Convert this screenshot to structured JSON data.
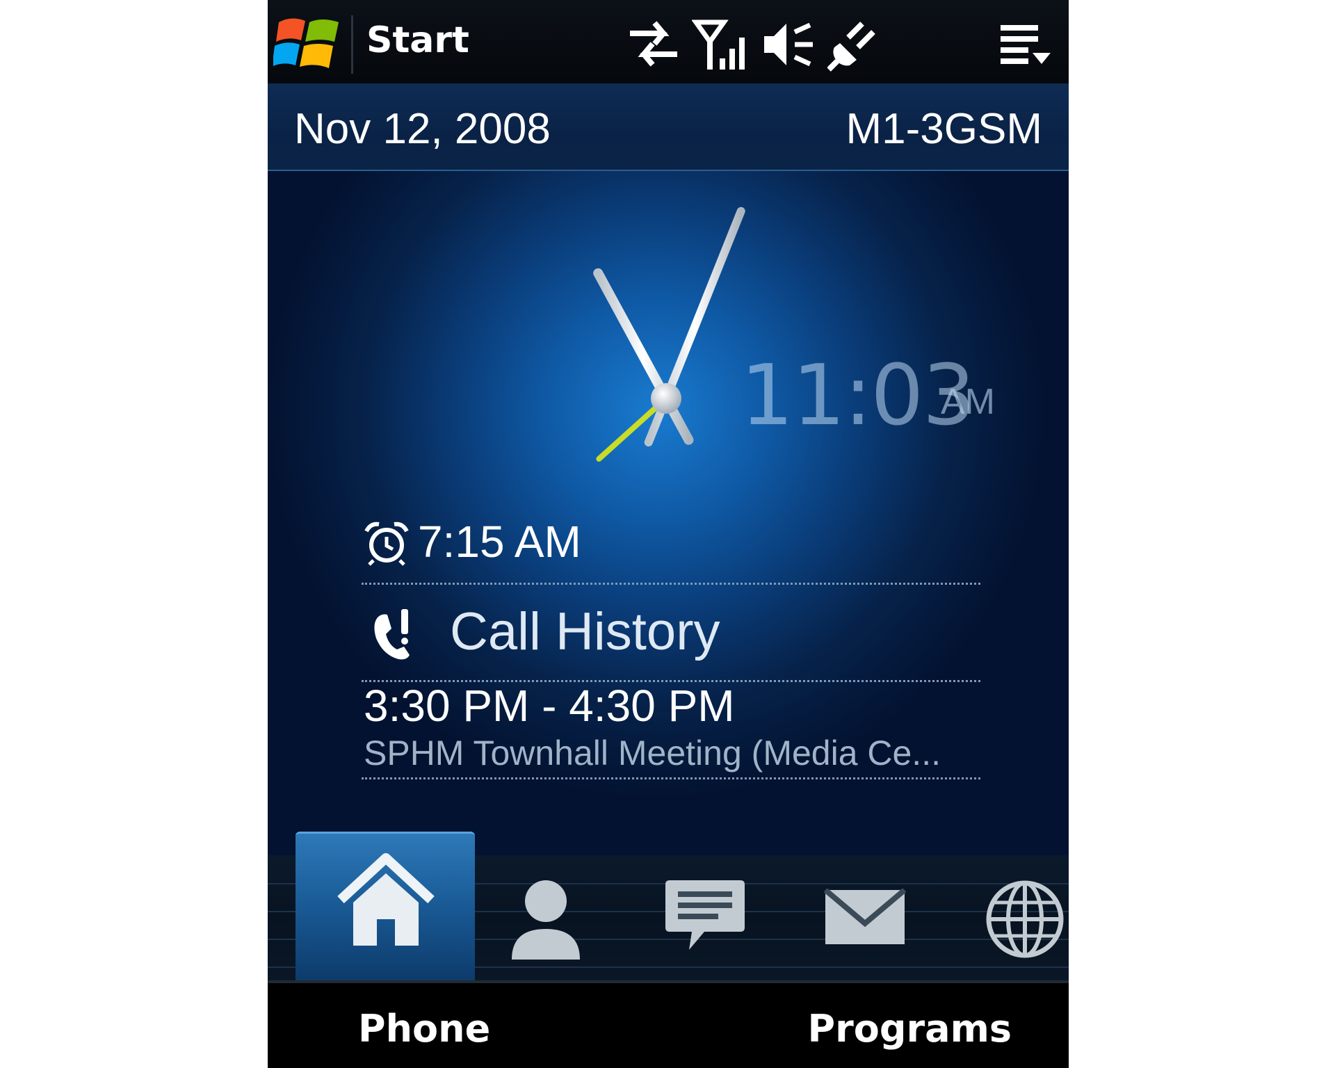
{
  "title_bar": {
    "label": "Start",
    "icons": [
      "windows-logo-icon",
      "data-sync-icon",
      "signal-icon",
      "speaker-muted-icon",
      "power-plug-icon",
      "menu-list-icon"
    ]
  },
  "home": {
    "date": "Nov 12, 2008",
    "operator": "M1-3GSM",
    "clock": {
      "digital_time": "11:03",
      "ampm": "AM",
      "hour": 11,
      "minute": 3,
      "second": 38
    },
    "alarm": {
      "icon": "alarm-clock-icon",
      "time": "7:15 AM"
    },
    "call_history": {
      "icon": "missed-call-icon",
      "label": "Call History"
    },
    "appointment": {
      "time_range": "3:30 PM - 4:30 PM",
      "title": "SPHM Townhall Meeting (Media Ce..."
    }
  },
  "tabs": [
    {
      "icon": "home-icon",
      "selected": true
    },
    {
      "icon": "person-icon",
      "selected": false
    },
    {
      "icon": "message-icon",
      "selected": false
    },
    {
      "icon": "mail-icon",
      "selected": false
    },
    {
      "icon": "globe-icon",
      "selected": false
    }
  ],
  "softkeys": {
    "left": "Phone",
    "right": "Programs"
  },
  "colors": {
    "accent": "#1a7bd0",
    "second_hand": "#c8dc28"
  }
}
